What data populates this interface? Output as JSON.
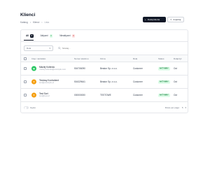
{
  "header": {
    "title": "Klienci",
    "breadcrumb": [
      "Katalog",
      "Klienci",
      "Lista"
    ],
    "add_button": "Dodaj klienta",
    "import_button": "Importuj"
  },
  "tabs": [
    {
      "label": "All",
      "count": "3"
    },
    {
      "label": "Aktywni",
      "count": "3"
    },
    {
      "label": "Nieaktywni",
      "count": "0"
    }
  ],
  "toolbar": {
    "filter_label": "Rola",
    "search_placeholder": "Szukaj..."
  },
  "table": {
    "columns": [
      "Imię i nazwisko",
      "Numer telefonu",
      "Firma",
      "Rola",
      "Status",
      "Dołączył"
    ],
    "rows": [
      {
        "initial": "M",
        "avatar_color": "#22c55e",
        "name": "Maciej Kolenda",
        "email": "maciej.kolenda@example.com",
        "phone": "504706090",
        "company": "Beaton Sp. z o.o.",
        "role": "Customer",
        "status": "AKTYWNY",
        "date": "Oct"
      },
      {
        "initial": "T",
        "avatar_color": "#f59e0b",
        "name": "Testowy Kontrahent",
        "email": "test@example.pl",
        "phone": "504329641",
        "company": "Beaton Sp. z o.o.",
        "role": "Customer",
        "status": "AKTYWNY",
        "date": "Oct"
      },
      {
        "initial": "T",
        "avatar_color": "#f59e0b",
        "name": "Test Sort",
        "email": "test@test.pl",
        "phone": "000000000",
        "company": "TESTOWE",
        "role": "Customer",
        "status": "AKTYWNY",
        "date": "Oct"
      }
    ]
  },
  "footer": {
    "dense_label": "Gęsto",
    "rows_per_page_label": "Rows per page:",
    "rows_per_page_value": "5"
  },
  "colors": {
    "primary": "#111827",
    "active_green": "#15803d",
    "active_green_bg": "#dcfce7"
  }
}
